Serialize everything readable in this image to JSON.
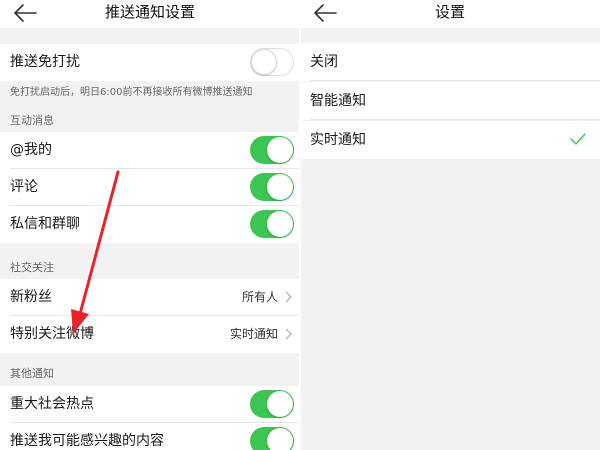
{
  "left": {
    "title": "推送通知设置",
    "dnd": {
      "label": "推送免打扰",
      "enabled": false
    },
    "dnd_note": "免打扰启动后，明日6:00前不再接收所有微博推送通知",
    "interaction": {
      "header": "互动消息",
      "items": [
        {
          "label": "@我的",
          "enabled": true
        },
        {
          "label": "评论",
          "enabled": true
        },
        {
          "label": "私信和群聊",
          "enabled": true
        }
      ]
    },
    "social": {
      "header": "社交关注",
      "items": [
        {
          "label": "新粉丝",
          "value": "所有人"
        },
        {
          "label": "特别关注微博",
          "value": "实时通知"
        }
      ]
    },
    "other": {
      "header": "其他通知",
      "items": [
        {
          "label": "重大社会热点",
          "enabled": true
        },
        {
          "label": "推送我可能感兴趣的内容",
          "enabled": true
        }
      ]
    }
  },
  "right": {
    "title": "设置",
    "options": [
      {
        "label": "关闭",
        "selected": false
      },
      {
        "label": "智能通知",
        "selected": false
      },
      {
        "label": "实时通知",
        "selected": true
      }
    ]
  },
  "colors": {
    "toggle_on": "#3cc552",
    "check": "#3cc552",
    "annotation_arrow": "#e8242a",
    "background": "#f2f2f2"
  },
  "icons": [
    "back-arrow-icon",
    "chevron-right-icon",
    "checkmark-icon",
    "annotation-arrow"
  ]
}
